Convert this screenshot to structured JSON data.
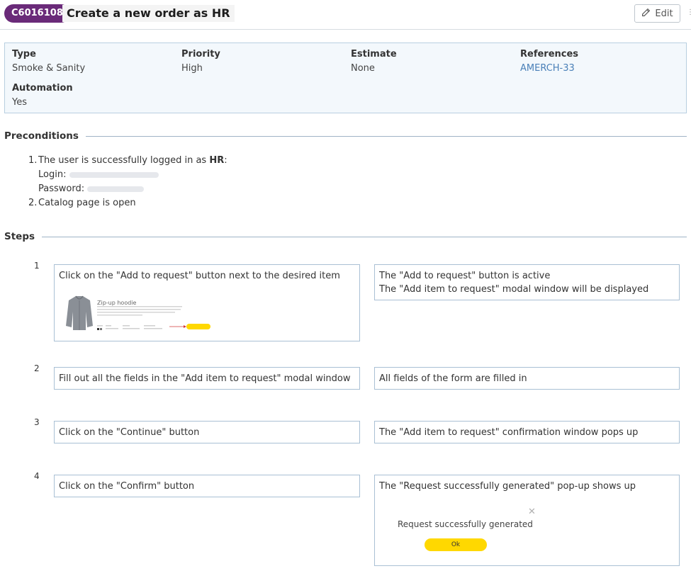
{
  "header": {
    "case_id": "C6016108",
    "title": "Create a new order as HR",
    "edit_label": "Edit"
  },
  "info": {
    "type_label": "Type",
    "type_value": "Smoke & Sanity",
    "priority_label": "Priority",
    "priority_value": "High",
    "estimate_label": "Estimate",
    "estimate_value": "None",
    "references_label": "References",
    "references_value": "AMERCH-33",
    "automation_label": "Automation",
    "automation_value": "Yes"
  },
  "preconditions": {
    "title": "Preconditions",
    "item1_prefix": "The user is successfully logged in as ",
    "item1_role": "HR",
    "item1_suffix": ":",
    "login_label": "Login:",
    "password_label": "Password:",
    "item2": "Catalog page is open"
  },
  "steps": {
    "title": "Steps",
    "items": [
      {
        "num": "1",
        "action": "Click on the \"Add to request\" button next to the desired item",
        "expected_line1": "The \"Add to request\" button is active",
        "expected_line2": "The \"Add item to request\" modal window will be displayed",
        "thumb_title": "Zip-up hoodie"
      },
      {
        "num": "2",
        "action": "Fill out all the fields in the \"Add item to request\" modal window",
        "expected": "All fields of the form are filled in"
      },
      {
        "num": "3",
        "action": "Click on the \"Continue\" button",
        "expected": "The \"Add item to request\" confirmation window pops up"
      },
      {
        "num": "4",
        "action": "Click on the \"Confirm\" button",
        "expected": "The \"Request successfully generated\" pop-up shows up",
        "popup_message": "Request successfully generated",
        "popup_ok": "Ok"
      }
    ]
  },
  "colors": {
    "badge": "#6a2a79",
    "accent_yellow": "#ffd800",
    "link": "#4a80b8",
    "panel_bg": "#f3f8fc"
  }
}
